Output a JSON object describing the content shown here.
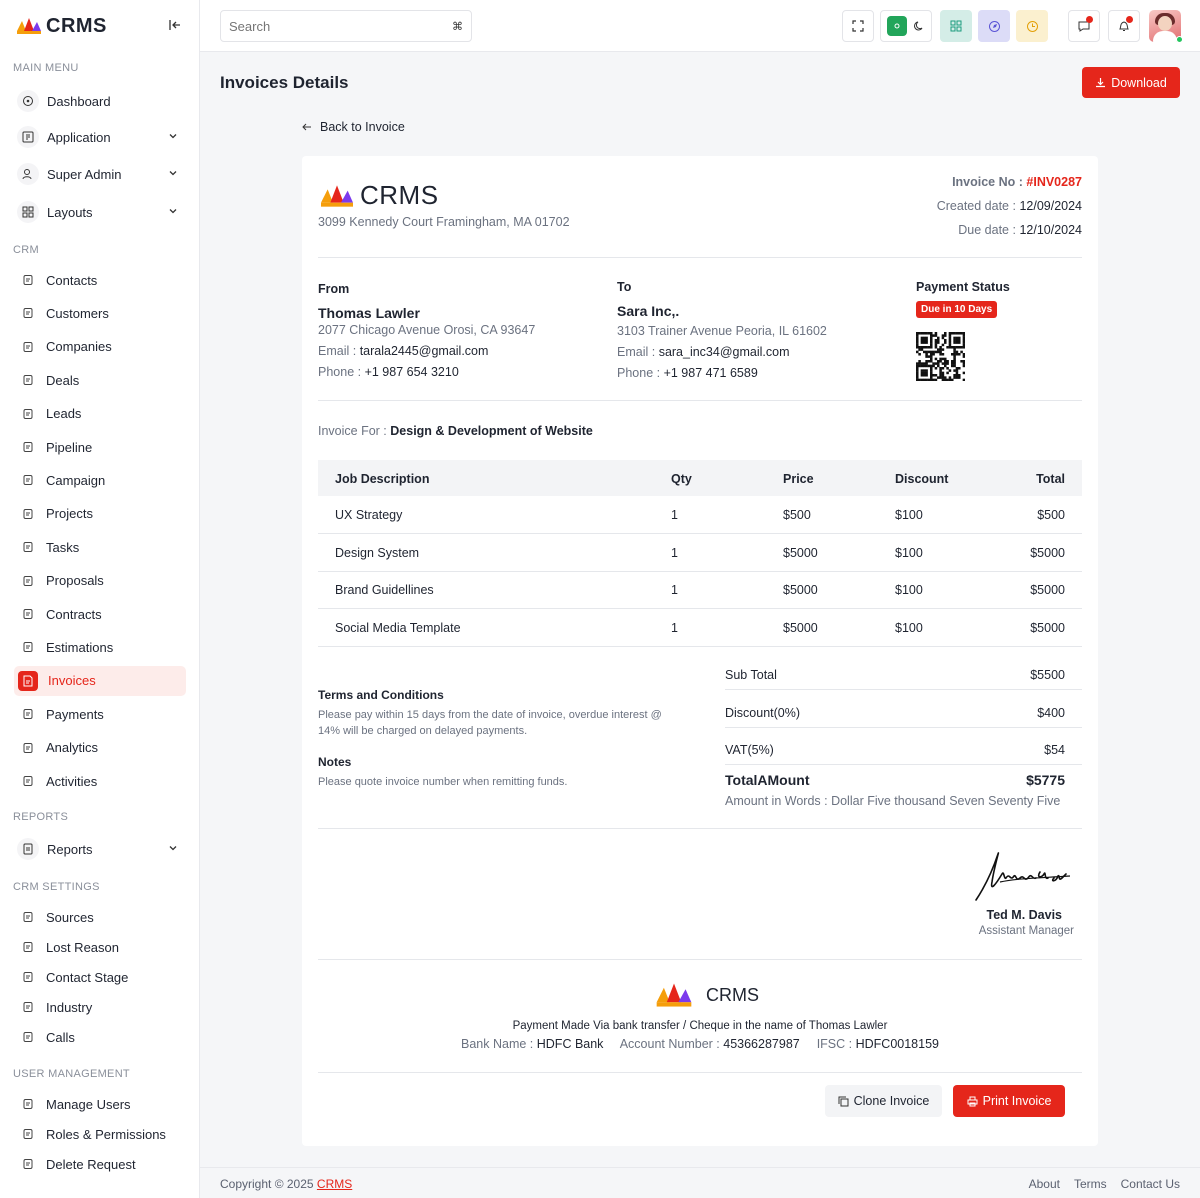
{
  "brand": {
    "name": "CRMS"
  },
  "header": {
    "search_placeholder": "Search",
    "search_shortcut": "⌘"
  },
  "sidebar": {
    "sections": {
      "main_menu": "MAIN MENU",
      "crm": "CRM",
      "reports": "REPORTS",
      "crm_settings": "CRM SETTINGS",
      "user_management": "USER MANAGEMENT"
    },
    "main_items": [
      "Dashboard",
      "Application",
      "Super Admin",
      "Layouts"
    ],
    "crm_items": [
      "Contacts",
      "Customers",
      "Companies",
      "Deals",
      "Leads",
      "Pipeline",
      "Campaign",
      "Projects",
      "Tasks",
      "Proposals",
      "Contracts",
      "Estimations",
      "Invoices",
      "Payments",
      "Analytics",
      "Activities"
    ],
    "reports_items": [
      "Reports"
    ],
    "settings_items": [
      "Sources",
      "Lost Reason",
      "Contact Stage",
      "Industry",
      "Calls"
    ],
    "user_items": [
      "Manage Users",
      "Roles & Permissions",
      "Delete Request"
    ],
    "active": "Invoices"
  },
  "page": {
    "title": "Invoices Details",
    "download_label": "Download",
    "back_label": "Back to Invoice"
  },
  "invoice": {
    "company_name": "CRMS",
    "company_address": "3099 Kennedy Court Framingham, MA 01702",
    "number_label": "Invoice No :",
    "number": "#INV0287",
    "created_label": "Created date :",
    "created": "12/09/2024",
    "due_label": "Due date :",
    "due": "12/10/2024",
    "from": {
      "label": "From",
      "name": "Thomas Lawler",
      "address": "2077 Chicago Avenue Orosi, CA 93647",
      "email_label": "Email :",
      "email": "tarala2445@gmail.com",
      "phone_label": "Phone :",
      "phone": "+1 987 654 3210"
    },
    "to": {
      "label": "To",
      "name": "Sara Inc,.",
      "address": "3103 Trainer Avenue Peoria, IL 61602",
      "email_label": "Email :",
      "email": "sara_inc34@gmail.com",
      "phone_label": "Phone :",
      "phone": "+1 987 471 6589"
    },
    "payment_status_label": "Payment Status",
    "payment_status": "Due in 10 Days",
    "invoice_for_label": "Invoice For :",
    "invoice_for": "Design & Development of Website",
    "columns": [
      "Job Description",
      "Qty",
      "Price",
      "Discount",
      "Total"
    ],
    "rows": [
      [
        "UX Strategy",
        "1",
        "$500",
        "$100",
        "$500"
      ],
      [
        "Design System",
        "1",
        "$5000",
        "$100",
        "$5000"
      ],
      [
        "Brand Guidellines",
        "1",
        "$5000",
        "$100",
        "$5000"
      ],
      [
        "Social Media Template",
        "1",
        "$5000",
        "$100",
        "$5000"
      ]
    ],
    "terms_title": "Terms and Conditions",
    "terms_text_1": "Please pay within 15 days from the date of invoice, overdue interest @",
    "terms_text_2": "14% will be charged on delayed payments.",
    "notes_title": "Notes",
    "notes_text": "Please quote invoice number when remitting funds.",
    "subtotal_label": "Sub Total",
    "subtotal": "$5500",
    "discount_label": "Discount(0%)",
    "discount": "$400",
    "vat_label": "VAT(5%)",
    "vat": "$54",
    "total_label": "TotalAMount",
    "total": "$5775",
    "words_label": "Amount in Words :",
    "words": "Dollar Five thousand Seven Seventy Five",
    "signer_name": "Ted M. Davis",
    "signer_title": "Assistant Manager",
    "payment_note": "Payment Made Via bank transfer / Cheque in the name of Thomas Lawler",
    "bank_label": "Bank Name :",
    "bank": "HDFC Bank",
    "account_label": "Account Number :",
    "account": "45366287987",
    "ifsc_label": "IFSC :",
    "ifsc": "HDFC0018159",
    "clone_label": "Clone Invoice",
    "print_label": "Print Invoice"
  },
  "footer": {
    "copyright": "Copyright © 2025",
    "brand_link": "CRMS",
    "links": [
      "About",
      "Terms",
      "Contact Us"
    ]
  },
  "colors": {
    "accent": "#e5261b",
    "active_bg": "#fdecea"
  }
}
